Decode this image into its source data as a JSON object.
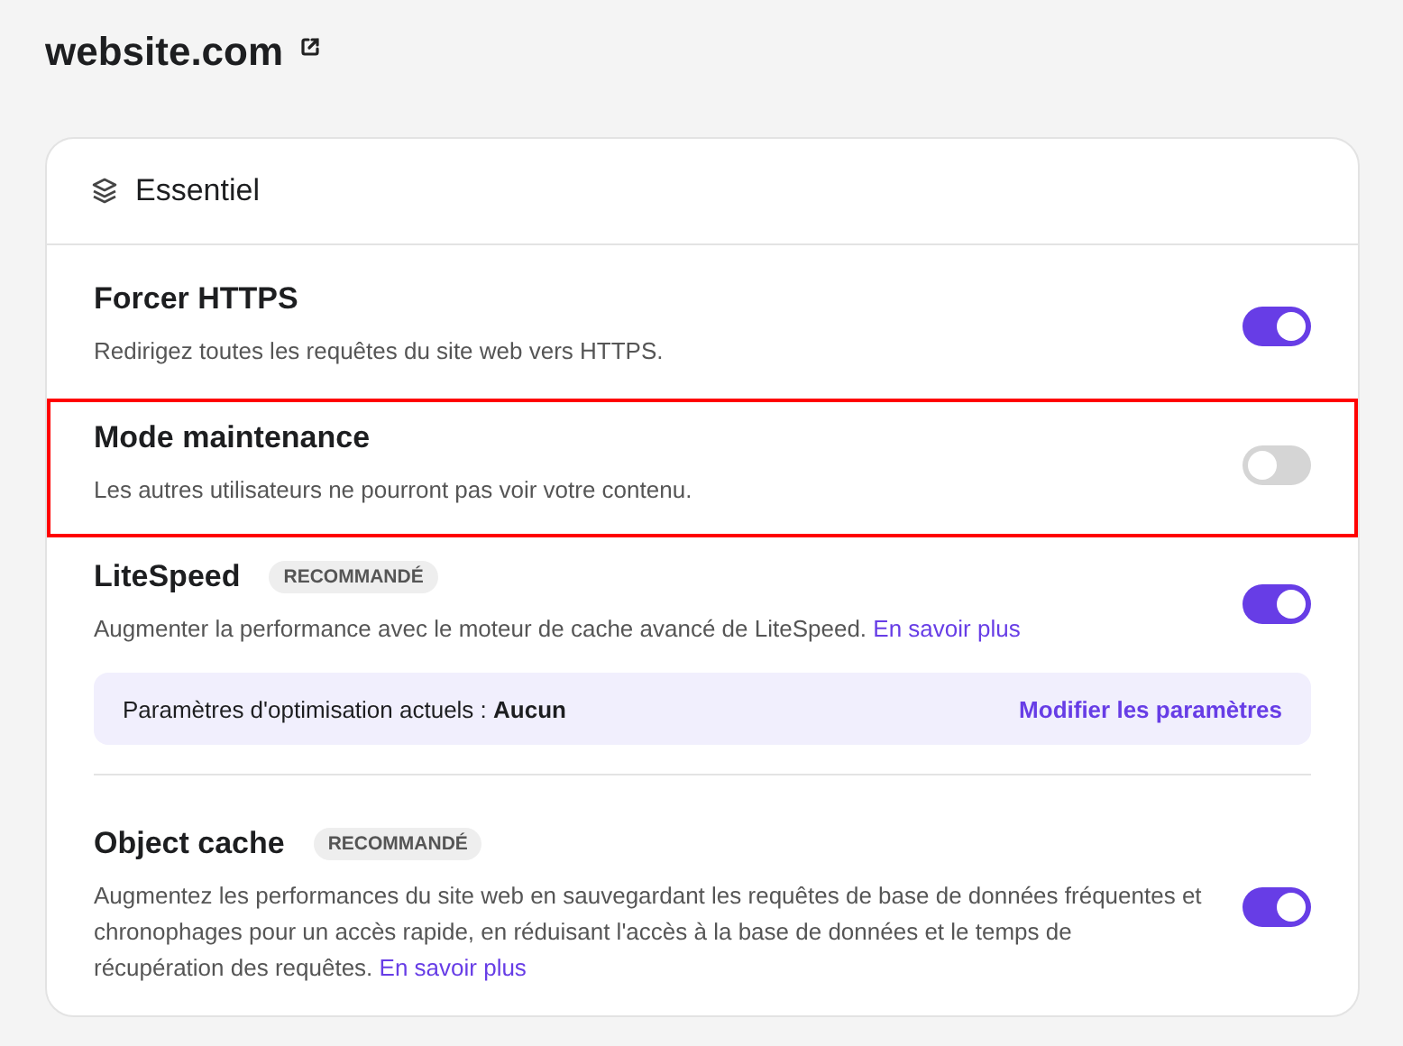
{
  "page": {
    "title": "website.com"
  },
  "section": {
    "title": "Essentiel",
    "items": [
      {
        "title": "Forcer HTTPS",
        "description": "Redirigez toutes les requêtes du site web vers HTTPS.",
        "on": true,
        "highlighted": false
      },
      {
        "title": "Mode maintenance",
        "description": "Les autres utilisateurs ne pourront pas voir votre contenu.",
        "on": false,
        "highlighted": true
      },
      {
        "title": "LiteSpeed",
        "badge": "RECOMMANDÉ",
        "description": "Augmenter la performance avec le moteur de cache avancé de LiteSpeed.",
        "link": "En savoir plus",
        "on": true,
        "highlighted": false,
        "optimisation": {
          "label": "Paramètres d'optimisation actuels :",
          "value": "Aucun",
          "action": "Modifier les paramètres"
        }
      },
      {
        "title": "Object cache",
        "badge": "RECOMMANDÉ",
        "description": "Augmentez les performances du site web en sauvegardant les requêtes de base de données fréquentes et chronophages pour un accès rapide, en réduisant l'accès à la base de données et le temps de récupération des requêtes.",
        "link": "En savoir plus",
        "on": true,
        "highlighted": false
      }
    ]
  }
}
